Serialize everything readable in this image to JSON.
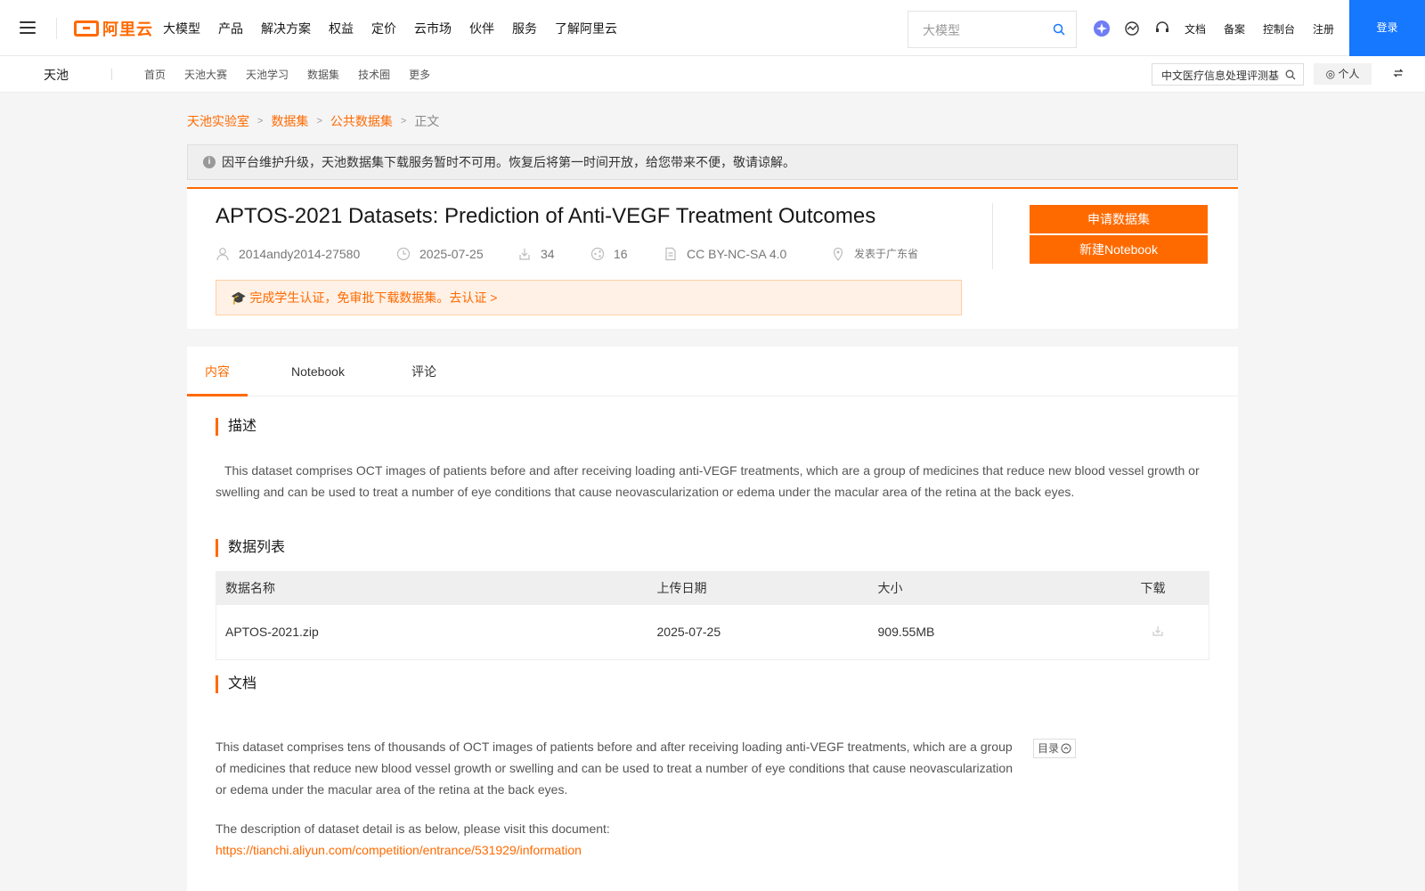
{
  "topbar": {
    "logo": "阿里云",
    "nav": [
      "大模型",
      "产品",
      "解决方案",
      "权益",
      "定价",
      "云市场",
      "伙伴",
      "服务",
      "了解阿里云"
    ],
    "search_placeholder": "大模型",
    "tools": [
      "文档",
      "备案",
      "控制台",
      "注册"
    ],
    "login": "登录"
  },
  "subbar": {
    "brand": "天池",
    "nav": [
      "首页",
      "天池大赛",
      "天池学习",
      "数据集",
      "技术圈",
      "更多"
    ],
    "search_value": "中文医疗信息处理评测基",
    "personal": "个人"
  },
  "breadcrumb": {
    "items": [
      "天池实验室",
      "数据集",
      "公共数据集"
    ],
    "current": "正文"
  },
  "notice": "因平台维护升级，天池数据集下载服务暂时不可用。恢复后将第一时间开放，给您带来不便，敬请谅解。",
  "dataset": {
    "title": "APTOS-2021 Datasets: Prediction of Anti-VEGF Treatment Outcomes",
    "author": "2014andy2014-27580",
    "date": "2025-07-25",
    "downloads": "34",
    "shares": "16",
    "license": "CC BY-NC-SA 4.0",
    "location": "发表于广东省",
    "cert": "完成学生认证，免审批下载数据集。去认证 >",
    "apply_btn": "申请数据集",
    "notebook_btn": "新建Notebook"
  },
  "tabs": [
    "内容",
    "Notebook",
    "评论"
  ],
  "content": {
    "desc_title": "描述",
    "desc_text": "This dataset comprises OCT images of patients before and after receiving loading anti-VEGF treatments, which are a group of medicines that reduce new blood vessel growth or swelling and can be used to treat a number of eye conditions that cause neovascularization or edema under the macular area of the retina at the back eyes.",
    "list_title": "数据列表",
    "columns": [
      "数据名称",
      "上传日期",
      "大小",
      "下载"
    ],
    "rows": [
      {
        "name": "APTOS-2021.zip",
        "date": "2025-07-25",
        "size": "909.55MB"
      }
    ],
    "doc_title": "文档",
    "doc_text": "This dataset comprises tens of thousands of OCT images of patients before and after receiving loading anti-VEGF treatments, which are a group of medicines that reduce new blood vessel growth or swelling and can be used to treat a number of eye conditions that cause neovascularization or edema under the macular area of the retina at the back eyes.",
    "doc_text2": "The description of dataset detail is as below, please visit this document:",
    "doc_link": "https://tianchi.aliyun.com/competition/entrance/531929/information",
    "toc": "目录"
  },
  "colors": {
    "accent": "#ff6a00",
    "login_blue": "#1677ff"
  }
}
